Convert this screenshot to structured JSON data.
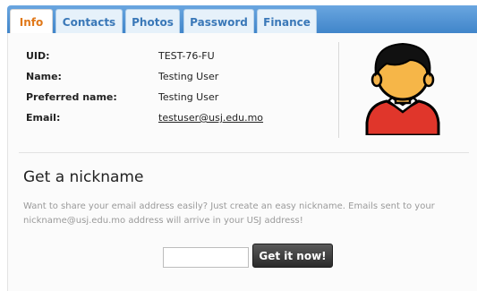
{
  "tabs": [
    {
      "label": "Info",
      "active": true
    },
    {
      "label": "Contacts",
      "active": false
    },
    {
      "label": "Photos",
      "active": false
    },
    {
      "label": "Password",
      "active": false
    },
    {
      "label": "Finance",
      "active": false
    }
  ],
  "profile": {
    "uid_label": "UID:",
    "uid_value": "TEST-76-FU",
    "name_label": "Name:",
    "name_value": "Testing User",
    "preferred_label": "Preferred name:",
    "preferred_value": "Testing User",
    "email_label": "Email:",
    "email_value": "testuser@usj.edu.mo"
  },
  "avatar": {
    "icon": "user-avatar-icon"
  },
  "nickname": {
    "title": "Get a nickname",
    "description": "Want to share your email address easily? Just create an easy nickname. Emails sent to your nickname@usj.edu.mo address will arrive in your USJ address!",
    "input_value": "",
    "button_label": "Get it now!"
  },
  "colors": {
    "tab_bar": "#3f84c9",
    "active_tab_text": "#e0781a",
    "tab_text": "#3a78b8",
    "button_bg": "#2a2a2a"
  }
}
